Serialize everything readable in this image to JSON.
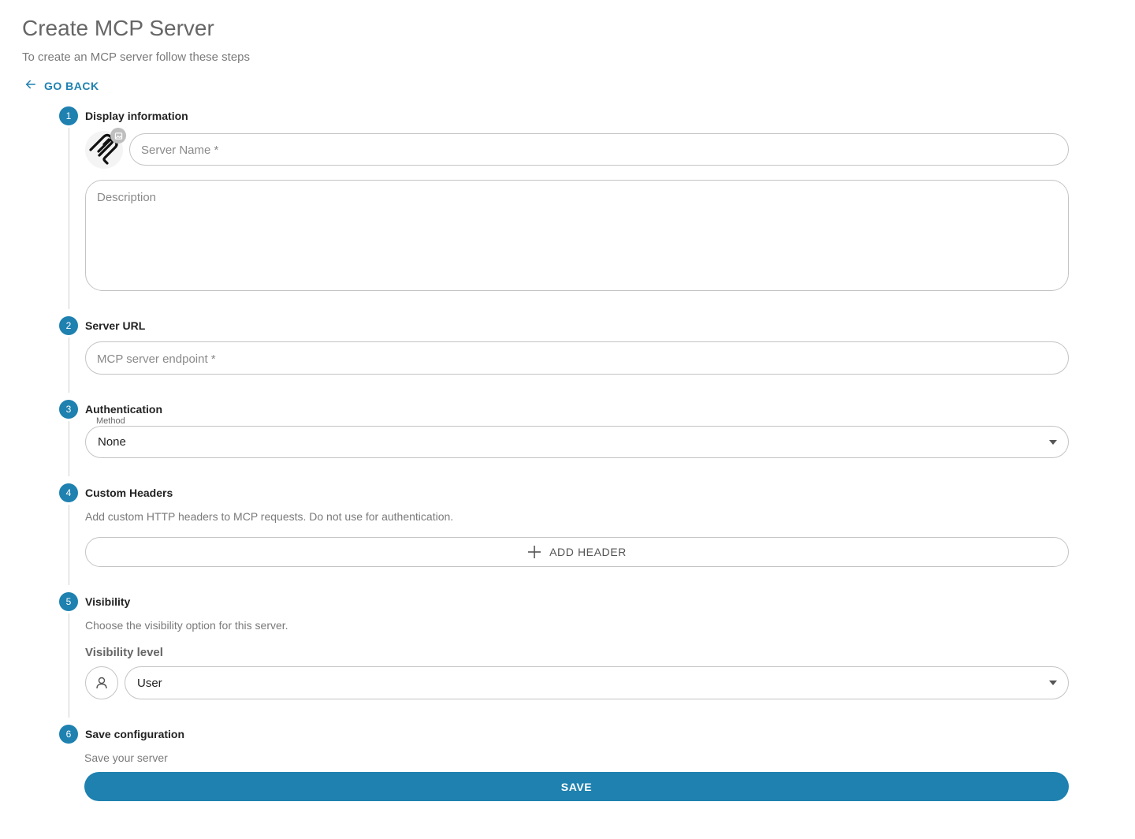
{
  "header": {
    "title": "Create MCP Server",
    "subtitle": "To create an MCP server follow these steps",
    "go_back_label": "GO BACK"
  },
  "steps": [
    {
      "number": "1",
      "title": "Display information"
    },
    {
      "number": "2",
      "title": "Server URL"
    },
    {
      "number": "3",
      "title": "Authentication"
    },
    {
      "number": "4",
      "title": "Custom Headers"
    },
    {
      "number": "5",
      "title": "Visibility"
    },
    {
      "number": "6",
      "title": "Save configuration"
    }
  ],
  "display_info": {
    "server_name_placeholder": "Server Name *",
    "description_placeholder": "Description",
    "server_name_value": "",
    "description_value": ""
  },
  "server_url": {
    "endpoint_placeholder": "MCP server endpoint *",
    "endpoint_value": ""
  },
  "authentication": {
    "method_label": "Method",
    "method_value": "None"
  },
  "custom_headers": {
    "hint": "Add custom HTTP headers to MCP requests. Do not use for authentication.",
    "add_header_label": "ADD HEADER"
  },
  "visibility": {
    "hint": "Choose the visibility option for this server.",
    "level_label": "Visibility level",
    "level_value": "User"
  },
  "save": {
    "hint": "Save your server",
    "button_label": "SAVE"
  },
  "colors": {
    "accent": "#1e81b0",
    "border": "#c4c4c4",
    "step_line": "#cfcfcf",
    "muted_text": "#7a7a7a"
  }
}
